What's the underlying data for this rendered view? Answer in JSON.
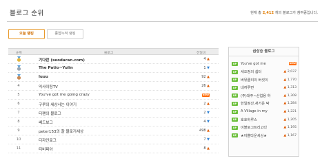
{
  "header": {
    "title": "블로그 순위",
    "summary_prefix": "현재 총",
    "summary_count": "2,412",
    "summary_suffix": "개의 블로그가 참여중입니다."
  },
  "tabs": [
    {
      "label": "오늘 랭킹",
      "active": true
    },
    {
      "label": "종합누적 랭킹",
      "active": false
    }
  ],
  "table": {
    "columns": {
      "rank": "순위",
      "blog": "블로그",
      "change": "전일비"
    },
    "rows": [
      {
        "rank": "1",
        "medal": "gold",
        "name": "기다란 (seodaran.com)",
        "bold": true,
        "change": "4",
        "dir": "up"
      },
      {
        "rank": "2",
        "medal": "silver",
        "name": "The Patio~Yulin",
        "bold": true,
        "change": "1",
        "dir": "down"
      },
      {
        "rank": "3",
        "medal": "bronze",
        "name": "luuu",
        "bold": true,
        "change": "92",
        "dir": "up"
      },
      {
        "rank": "4",
        "medal": "",
        "name": "익사이팅TV",
        "bold": false,
        "change": "26",
        "dir": "up"
      },
      {
        "rank": "5",
        "medal": "",
        "name": "You've got me going crazy",
        "bold": false,
        "change": "NEW",
        "dir": "new"
      },
      {
        "rank": "6",
        "medal": "",
        "name": "구루의 세상사는 이야기",
        "bold": false,
        "change": "2",
        "dir": "up"
      },
      {
        "rank": "7",
        "medal": "",
        "name": "티팬의 블로그",
        "bold": false,
        "change": "2",
        "dir": "down"
      },
      {
        "rank": "8",
        "medal": "",
        "name": "쎄드보그",
        "bold": false,
        "change": "4",
        "dir": "down"
      },
      {
        "rank": "9",
        "medal": "",
        "name": "peter153의 잘 블로거세상",
        "bold": false,
        "change": "498",
        "dir": "up"
      },
      {
        "rank": "10",
        "medal": "",
        "name": "디자인로그",
        "bold": false,
        "change": "7",
        "dir": "down"
      },
      {
        "rank": "11",
        "medal": "",
        "name": "티비피아",
        "bold": false,
        "change": "8",
        "dir": "up"
      }
    ]
  },
  "side_box": {
    "title": "급상승 블로그",
    "badge": "UP",
    "new_label": "NEW",
    "items": [
      {
        "name": "You've got me",
        "stat": "NEW",
        "is_new": true
      },
      {
        "name": "세오정의 쉼터",
        "stat": "2,037",
        "is_new": false
      },
      {
        "name": "버뮤클리의 버섯이",
        "stat": "1,770",
        "is_new": false
      },
      {
        "name": "네꺼루면",
        "stat": "1,313",
        "is_new": false
      },
      {
        "name": "(주)대주~산업용 하",
        "stat": "1,308",
        "is_new": false
      },
      {
        "name": "한일정산,새거운 탁",
        "stat": "1,284",
        "is_new": false
      },
      {
        "name": "A Village in my",
        "stat": "1,221",
        "is_new": false
      },
      {
        "name": "호호하루스",
        "stat": "1,205",
        "is_new": false
      },
      {
        "name": "이블로그트리고다",
        "stat": "1,195",
        "is_new": false
      },
      {
        "name": "★이쁠다운세상★",
        "stat": "1,167",
        "is_new": false
      }
    ]
  },
  "colors": {
    "accent": "#e89a2c",
    "up": "#e05a00",
    "down": "#2a7fd4",
    "badge_green": "#6cbf3c",
    "new_badge": "#ff6a00"
  },
  "icons": {
    "rank_medal": "medal-icon",
    "up": "arrow-up-icon",
    "down": "arrow-down-icon"
  }
}
